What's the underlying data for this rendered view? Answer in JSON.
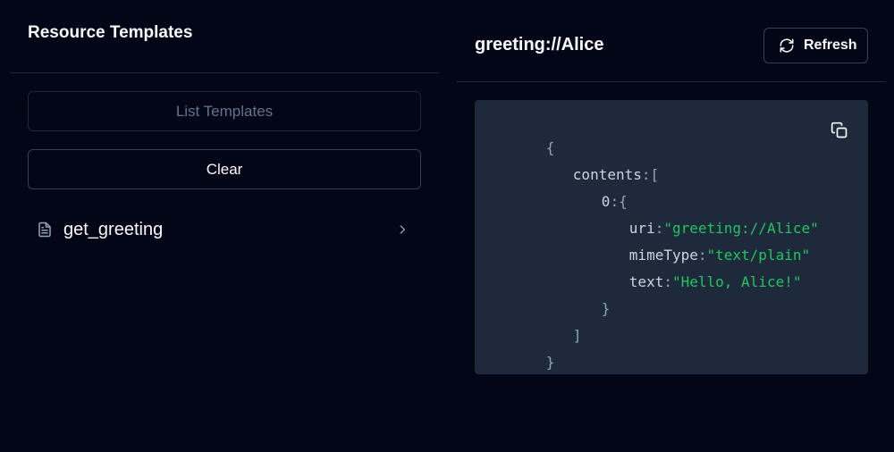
{
  "left": {
    "title": "Resource Templates",
    "list_button": "List Templates",
    "clear_button": "Clear",
    "templates": [
      {
        "name": "get_greeting"
      }
    ]
  },
  "right": {
    "title": "greeting://Alice",
    "refresh_button": "Refresh",
    "json": {
      "open_brace": "{",
      "contents_key": "contents",
      "colon": ":",
      "open_bracket": "[",
      "index_key": "0",
      "uri_key": "uri",
      "uri_value": "\"greeting://Alice\"",
      "mime_key": "mimeType",
      "mime_value": "\"text/plain\"",
      "text_key": "text",
      "text_value": "\"Hello, Alice!\"",
      "close_item": "}",
      "close_bracket": "]",
      "close_brace": "}"
    }
  },
  "colors": {
    "background": "#020617",
    "code_bg": "#1e293b",
    "string": "#22c55e",
    "muted": "#64748b"
  }
}
